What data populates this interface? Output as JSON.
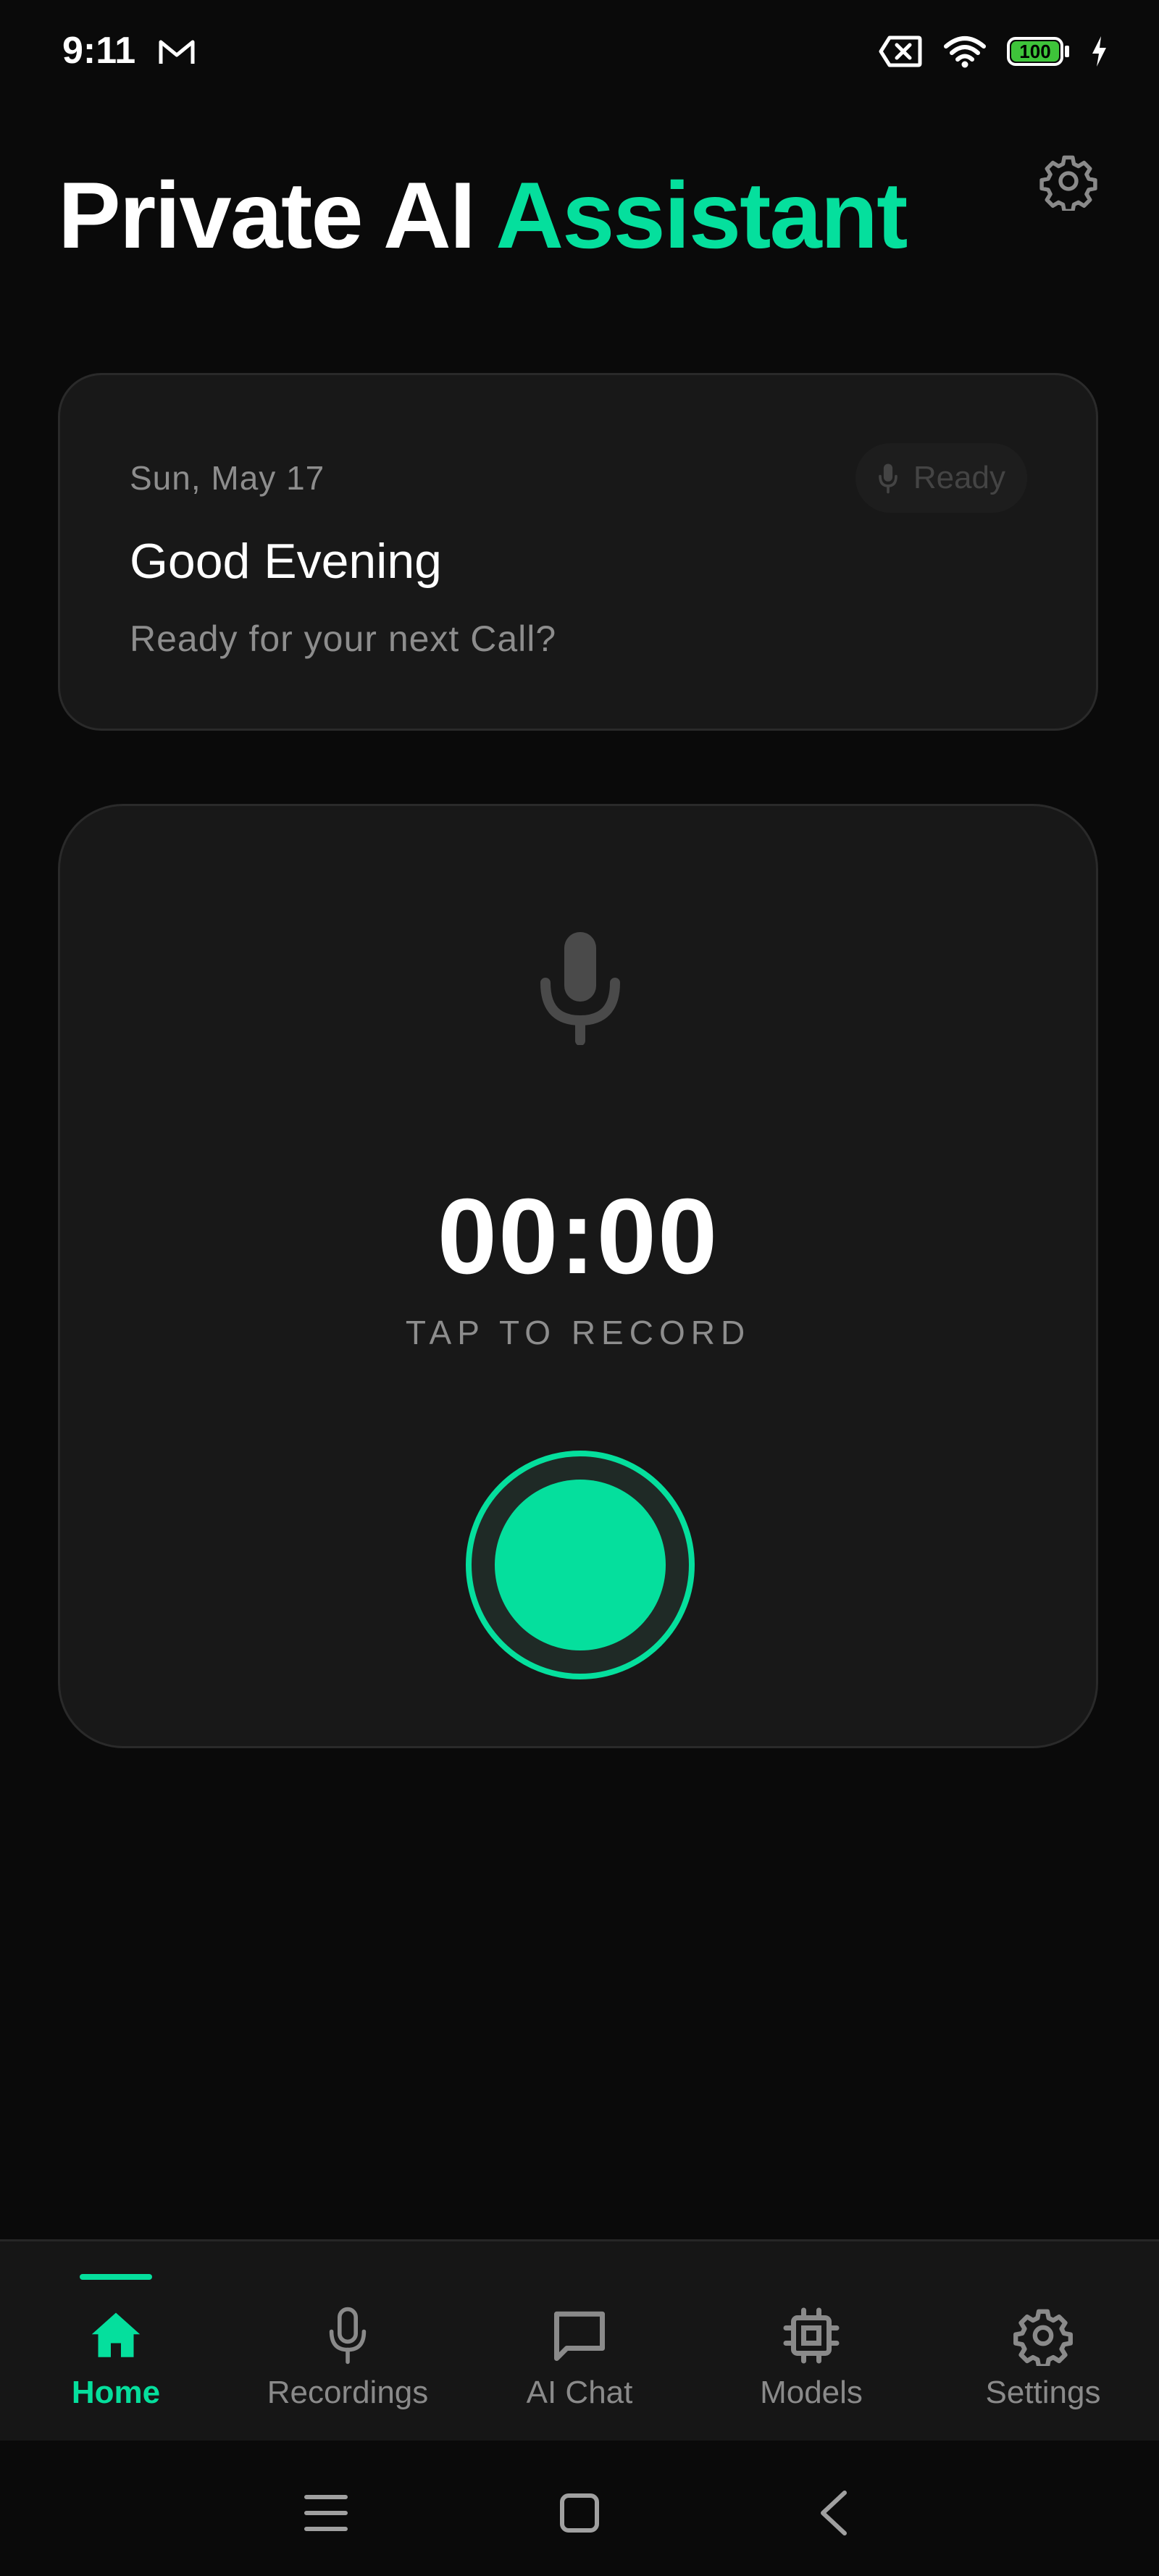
{
  "status_bar": {
    "time": "9:11",
    "battery_level": "100",
    "icons": [
      "gmail-icon",
      "sim-off-icon",
      "wifi-icon",
      "battery-icon",
      "charging-icon"
    ]
  },
  "header": {
    "title_main": "Private AI",
    "title_accent": "Assistant",
    "settings_icon": "gear-icon"
  },
  "greeting": {
    "date": "Sun, May 17",
    "title": "Good Evening",
    "subtitle": "Ready for your next Call?",
    "badge_label": "Ready"
  },
  "recorder": {
    "timer": "00:00",
    "tap_label": "TAP TO RECORD"
  },
  "nav": {
    "items": [
      {
        "label": "Home",
        "icon": "home-icon",
        "active": true
      },
      {
        "label": "Recordings",
        "icon": "mic-icon",
        "active": false
      },
      {
        "label": "AI Chat",
        "icon": "chat-icon",
        "active": false
      },
      {
        "label": "Models",
        "icon": "chip-icon",
        "active": false
      },
      {
        "label": "Settings",
        "icon": "gear-icon",
        "active": false
      }
    ]
  },
  "colors": {
    "accent": "#05df9d",
    "background": "#0a0a0a",
    "card": "#181818",
    "muted_text": "#8d8d8d"
  }
}
